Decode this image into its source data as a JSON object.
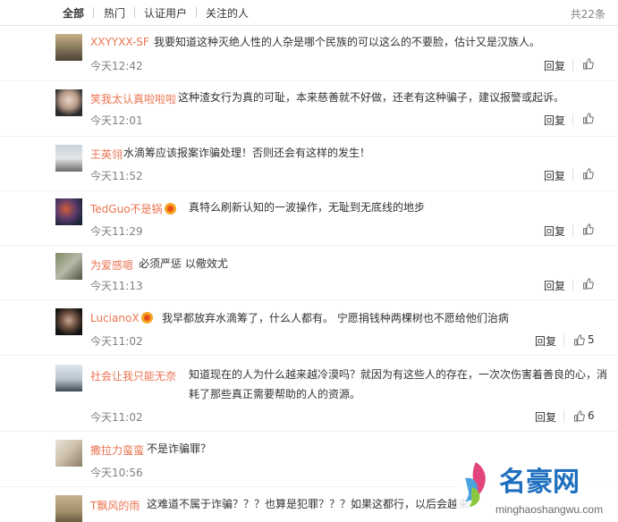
{
  "tabs": [
    "全部",
    "热门",
    "认证用户",
    "关注的人"
  ],
  "total": "共22条",
  "comments": [
    {
      "user": "XXYYXX-SF",
      "text": "我要知道这种灭绝人性的人杂是哪个民族的可以这么的不要脸，估计又是汉族人。",
      "time": "今天12:42",
      "reply": "回复",
      "likes": ""
    },
    {
      "user": "笑我太认真啦啦啦",
      "text": "这种渣女行为真的可耻，本来慈善就不好做，还老有这种骗子，建议报警或起诉。",
      "time": "今天12:01",
      "reply": "回复",
      "likes": ""
    },
    {
      "user": "王英翎",
      "text": "水滴筹应该报案诈骗处理！否则还会有这样的发生！",
      "time": "今天11:52",
      "reply": "回复",
      "likes": ""
    },
    {
      "user": "TedGuo不是锅",
      "text": "真特么刷新认知的一波操作，无耻到无底线的地步",
      "time": "今天11:29",
      "reply": "回复",
      "likes": ""
    },
    {
      "user": "为爱感嗯",
      "text": "必须严惩 以儆效尤",
      "time": "今天11:13",
      "reply": "回复",
      "likes": ""
    },
    {
      "user": "LucianoX",
      "text": "我早都放弃水滴筹了，什么人都有。 宁愿捐钱种两棵树也不愿给他们治病",
      "time": "今天11:02",
      "reply": "回复",
      "likes": "5"
    },
    {
      "user": "社会让我只能无奈",
      "text": "知道现在的人为什么越来越冷漠吗？就因为有这些人的存在，一次次伤害着善良的心，消耗了那些真正需要帮助的人的资源。",
      "time": "今天11:02",
      "reply": "回复",
      "likes": "6"
    },
    {
      "user": "撒拉力蛮蛮",
      "text": "不是诈骗罪？",
      "time": "今天10:56",
      "reply": "",
      "likes": ""
    },
    {
      "user": "T飘风的雨",
      "text": "这难道不属于诈骗？？？也算是犯罪？？？如果这都行，以后会越来",
      "time": "",
      "reply": "",
      "likes": ""
    }
  ],
  "watermark": {
    "name": "名豪网",
    "url": "minghaoshangwu.com"
  },
  "colors": {
    "username": "#eb7350",
    "muted": "#808080",
    "badge": "#f5a623"
  }
}
